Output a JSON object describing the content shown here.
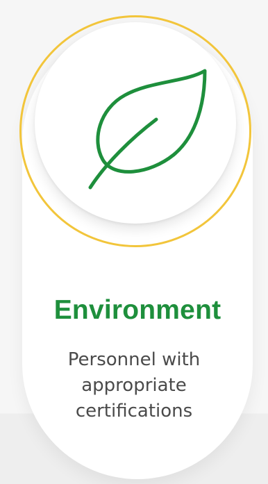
{
  "card": {
    "title": "Environment",
    "description": "Personnel with appropriate certifications"
  },
  "icon": {
    "name": "leaf-icon"
  },
  "colors": {
    "title": "#1e8f3c",
    "icon": "#1e8f3c",
    "ring": "#f2c53b",
    "text": "#4a4a4a"
  }
}
